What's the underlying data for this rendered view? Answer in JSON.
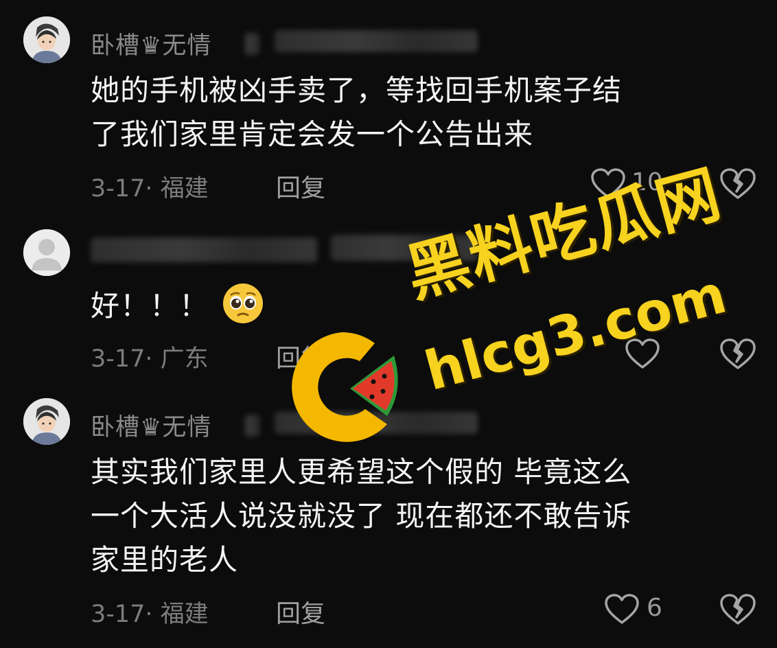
{
  "comments": [
    {
      "username": "卧槽♛无情",
      "text_lines": [
        "她的手机被凶手卖了，等找回手机案子结",
        "了我们家里肯定会发一个公告出来"
      ],
      "date_location": "3-17· 福建",
      "reply_label": "回复",
      "like_count": "10"
    },
    {
      "username": "",
      "text_lines": [
        "好！！！"
      ],
      "emoji": "pleading-face-emoji",
      "date_location": "3-17· 广东",
      "reply_label": "回复",
      "like_count": ""
    },
    {
      "username": "卧槽♛无情",
      "text_lines": [
        "其实我们家里人更希望这个假的 毕竟这么",
        "一个大活人说没就没了 现在都还不敢告诉",
        "家里的老人"
      ],
      "date_location": "3-17· 福建",
      "reply_label": "回复",
      "like_count": "6"
    }
  ],
  "watermark": {
    "title": "黑料吃瓜网",
    "url": "hlcg3.com",
    "color": "#f7d21e"
  },
  "icons": {
    "like": "heart-outline-icon",
    "dislike": "broken-heart-icon"
  },
  "colors": {
    "background": "#0c0c0c",
    "text": "#f4f4f4",
    "muted": "#7c7c7c"
  }
}
